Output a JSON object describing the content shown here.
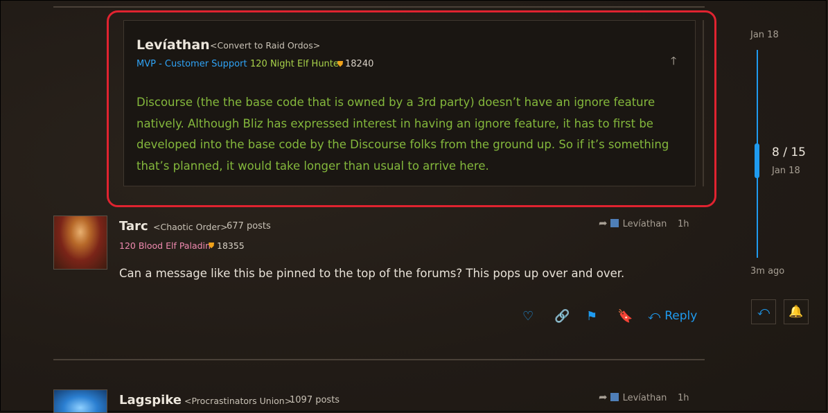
{
  "quote": {
    "author": "Levíathan",
    "guild": "<Convert to Raid Ordos>",
    "role": "MVP - Customer Support",
    "class_line": "120 Night Elf Hunter",
    "achievement_icon": "shield-icon",
    "achievements": "18240",
    "body": "Discourse (the the base code that is owned by a 3rd party) doesn’t have an ignore feature natively. Although Bliz has expressed interest in having an ignore feature, it has to first be developed into the base code by the Discourse folks from the ground up. So if it’s something that’s planned, it would take longer than usual to arrive here."
  },
  "posts": [
    {
      "author": "Tarc",
      "guild": "<Chaotic Order>",
      "post_count": "677 posts",
      "class_line": "120 Blood Elf Paladin",
      "achievements": "18355",
      "reply_to": "Levíathan",
      "time": "1h",
      "body": "Can a message like this be pinned to the top of the forums? This pops up over and over."
    },
    {
      "author": "Lagspike",
      "guild": "<Procrastinators Union>",
      "post_count": "1097 posts",
      "reply_to": "Levíathan",
      "time": "1h"
    }
  ],
  "actions": {
    "reply_label": "Reply",
    "icons": [
      "heart-icon",
      "link-icon",
      "flag-icon",
      "bookmark-icon",
      "reply-icon"
    ]
  },
  "timeline": {
    "start_date": "Jan 18",
    "position": "8 / 15",
    "position_date": "Jan 18",
    "end_label": "3m ago"
  },
  "colors": {
    "accent": "#1f9bf0",
    "highlight_border": "#e02330",
    "quote_text": "#84b83c",
    "hunter_class": "#a8d24a",
    "paladin_class": "#f08ab0"
  }
}
